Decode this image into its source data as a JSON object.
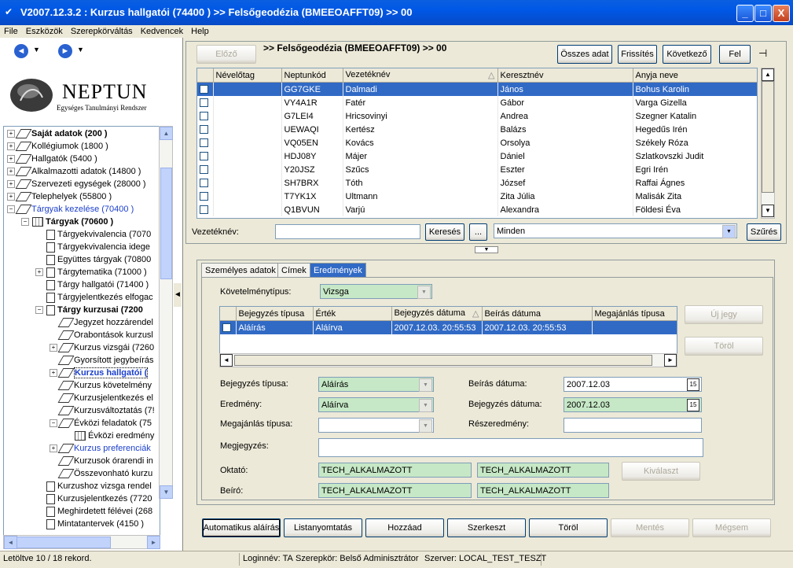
{
  "window": {
    "title": "V2007.12.3.2 : Kurzus hallgatói (74400  )  >> Felsőgeodézia (BMEEOAFFT09) >> 00",
    "min": "_",
    "max": "□",
    "close": "X"
  },
  "menu": [
    "File",
    "Eszközök",
    "Szerepkörváltás",
    "Kedvencek",
    "Help"
  ],
  "nav": {
    "back": "◄",
    "forward": "►",
    "dropdown": "▼"
  },
  "logo": {
    "name": "NEPTUN",
    "subtitle": "Egységes Tanulmányi Rendszer"
  },
  "tree": [
    {
      "label": "Saját adatok (200 )",
      "level": 0,
      "exp": "+",
      "icon": "dia",
      "bold": true
    },
    {
      "label": "Kollégiumok (1800 )",
      "level": 0,
      "exp": "+",
      "icon": "dia"
    },
    {
      "label": "Hallgatók (5400 )",
      "level": 0,
      "exp": "+",
      "icon": "dia"
    },
    {
      "label": "Alkalmazotti adatok (14800 )",
      "level": 0,
      "exp": "+",
      "icon": "dia"
    },
    {
      "label": "Szervezeti egységek (28000 )",
      "level": 0,
      "exp": "+",
      "icon": "dia"
    },
    {
      "label": "Telephelyek (55800 )",
      "level": 0,
      "exp": "+",
      "icon": "dia"
    },
    {
      "label": "Tárgyak kezelése (70400 )",
      "level": 0,
      "exp": "−",
      "icon": "dia",
      "blue": true
    },
    {
      "label": "Tárgyak (70600 )",
      "level": 1,
      "exp": "−",
      "icon": "grid",
      "bold": true
    },
    {
      "label": "Tárgyekvivalencia (7070",
      "level": 2,
      "exp": "",
      "icon": "doc"
    },
    {
      "label": "Tárgyekvivalencia idege",
      "level": 2,
      "exp": "",
      "icon": "doc"
    },
    {
      "label": "Együttes tárgyak (70800",
      "level": 2,
      "exp": "",
      "icon": "doc"
    },
    {
      "label": "Tárgytematika (71000 )",
      "level": 2,
      "exp": "+",
      "icon": "doc"
    },
    {
      "label": "Tárgy hallgatói (71400 )",
      "level": 2,
      "exp": "",
      "icon": "doc"
    },
    {
      "label": "Tárgyjelentkezés elfogac",
      "level": 2,
      "exp": "",
      "icon": "doc"
    },
    {
      "label": "Tárgy kurzusai (7200",
      "level": 2,
      "exp": "−",
      "icon": "doc",
      "bold": true
    },
    {
      "label": "Jegyzet hozzárendel",
      "level": 3,
      "exp": "",
      "icon": "dia"
    },
    {
      "label": "Orabontások kurzusl",
      "level": 3,
      "exp": "",
      "icon": "dia"
    },
    {
      "label": "Kurzus vizsgái (7260",
      "level": 3,
      "exp": "+",
      "icon": "dia"
    },
    {
      "label": "Gyorsított jegybeírás",
      "level": 3,
      "exp": "",
      "icon": "dia"
    },
    {
      "label": "Kurzus hallgatói (",
      "level": 3,
      "exp": "+",
      "icon": "dia",
      "bold": true,
      "blue": true,
      "selected": true
    },
    {
      "label": "Kurzus követelmény",
      "level": 3,
      "exp": "",
      "icon": "dia"
    },
    {
      "label": "Kurzusjelentkezés el",
      "level": 3,
      "exp": "",
      "icon": "dia"
    },
    {
      "label": "Kurzusváltoztatás (7!",
      "level": 3,
      "exp": "",
      "icon": "dia"
    },
    {
      "label": "Évközi feladatok (75",
      "level": 3,
      "exp": "−",
      "icon": "dia"
    },
    {
      "label": "Évközi eredmény",
      "level": 4,
      "exp": "",
      "icon": "grid"
    },
    {
      "label": "Kurzus preferenciák",
      "level": 3,
      "exp": "+",
      "icon": "dia",
      "blue": true
    },
    {
      "label": "Kurzusok órarendi in",
      "level": 3,
      "exp": "",
      "icon": "dia"
    },
    {
      "label": "Összevonható kurzu",
      "level": 3,
      "exp": "",
      "icon": "dia"
    },
    {
      "label": "Kurzushoz vizsga rendel",
      "level": 2,
      "exp": "",
      "icon": "doc"
    },
    {
      "label": "Kurzusjelentkezés (7720",
      "level": 2,
      "exp": "",
      "icon": "doc"
    },
    {
      "label": "Meghirdetett félévei (268",
      "level": 2,
      "exp": "",
      "icon": "doc"
    },
    {
      "label": "Mintatantervek (4150 )",
      "level": 2,
      "exp": "",
      "icon": "doc"
    }
  ],
  "toolbar": {
    "prev": "Előző",
    "crumb": ">> Felsőgeodézia (BMEEOAFFT09) >> 00",
    "all_data": "Összes adat",
    "refresh": "Frissítés",
    "next": "Következő",
    "up": "Fel",
    "pin": "⊣"
  },
  "grid1": {
    "columns": [
      "",
      "Névelőtag",
      "Neptunkód",
      "Vezetéknév",
      "Keresztnév",
      "Anyja neve"
    ],
    "sort_indicator": "△",
    "rows": [
      [
        "",
        "GG7GKE",
        "Dalmadi",
        "János",
        "Bohus Karolin"
      ],
      [
        "",
        "VY4A1R",
        "Fatér",
        "Gábor",
        "Varga Gizella"
      ],
      [
        "",
        "G7LEI4",
        "Hricsovinyi",
        "Andrea",
        "Szegner Katalin"
      ],
      [
        "",
        "UEWAQI",
        "Kertész",
        "Balázs",
        "Hegedűs Irén"
      ],
      [
        "",
        "VQ05EN",
        "Kovács",
        "Orsolya",
        "Székely Róza"
      ],
      [
        "",
        "HDJ08Y",
        "Májer",
        "Dániel",
        "Szlatkovszki Judit"
      ],
      [
        "",
        "Y20JSZ",
        "Szűcs",
        "Eszter",
        "Egri Irén"
      ],
      [
        "",
        "SH7BRX",
        "Tóth",
        "József",
        "Raffai Ágnes"
      ],
      [
        "",
        "T7YK1X",
        "Ultmann",
        "Zita Júlia",
        "Malisák Zita"
      ],
      [
        "",
        "Q1BVUN",
        "Varjú",
        "Alexandra",
        "Földesi Éva"
      ]
    ]
  },
  "filter": {
    "label": "Vezetéknév:",
    "value": "",
    "search": "Keresés",
    "dots": "...",
    "combo": "Minden",
    "filter_btn": "Szűrés",
    "splitter": "▼"
  },
  "tabs": [
    "Személyes adatok",
    "Címek",
    "Eredmények"
  ],
  "results": {
    "req_type_label": "Követelménytípus:",
    "req_type_value": "Vizsga",
    "grid2_columns": [
      "",
      "Bejegyzés típusa",
      "Érték",
      "Bejegyzés dátuma",
      "Beírás dátuma",
      "Megajánlás típusa"
    ],
    "grid2_rows": [
      [
        "Aláírás",
        "Aláírva",
        "2007.12.03. 20:55:53",
        "2007.12.03. 20:55:53",
        ""
      ]
    ],
    "new_grade": "Új jegy",
    "delete": "Töröl",
    "entry_type_label": "Bejegyzés típusa:",
    "entry_type_value": "Aláírás",
    "result_label": "Eredmény:",
    "result_value": "Aláírva",
    "offer_type_label": "Megajánlás típusa:",
    "offer_type_value": "",
    "write_date_label": "Beírás dátuma:",
    "write_date_value": "2007.12.03",
    "entry_date_label": "Bejegyzés dátuma:",
    "entry_date_value": "2007.12.03",
    "partial_label": "Részeredmény:",
    "partial_value": "",
    "note_label": "Megjegyzés:",
    "note_value": "",
    "teacher_label": "Oktató:",
    "teacher_value1": "TECH_ALKALMAZOTT",
    "teacher_value2": "TECH_ALKALMAZOTT",
    "select": "Kiválaszt",
    "writer_label": "Beíró:",
    "writer_value1": "TECH_ALKALMAZOTT",
    "writer_value2": "TECH_ALKALMAZOTT",
    "cal": "15"
  },
  "actions": {
    "auto_sign": "Automatikus aláírás",
    "list_print": "Listanyomtatás",
    "add": "Hozzáad",
    "edit": "Szerkeszt",
    "delete": "Töröl",
    "save": "Mentés",
    "cancel": "Mégsem"
  },
  "status": {
    "loaded": "Letöltve 10 / 18 rekord.",
    "login": "Loginnév: TA",
    "role": "Szerepkör: Belső Adminisztrátor",
    "server": "Szerver: LOCAL_TEST_TESZT"
  }
}
